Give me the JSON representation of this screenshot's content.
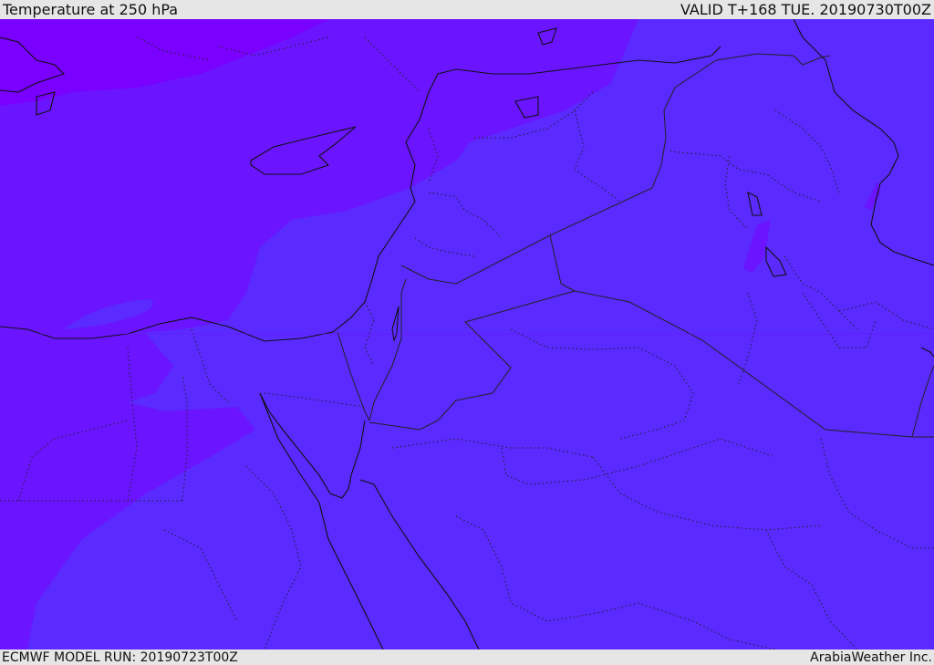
{
  "header": {
    "title": "Temperature at 250 hPa",
    "valid": "VALID T+168 TUE. 20190730T00Z"
  },
  "footer": {
    "model_run": "ECMWF MODEL RUN: 20190723T00Z",
    "credit": "ArabiaWeather Inc."
  },
  "map": {
    "colors": {
      "warm_band": "#7a00ff",
      "mid_band": "#6b14ff",
      "cool_band": "#5a2aff",
      "coast": "#111111",
      "border": "#222222"
    }
  }
}
